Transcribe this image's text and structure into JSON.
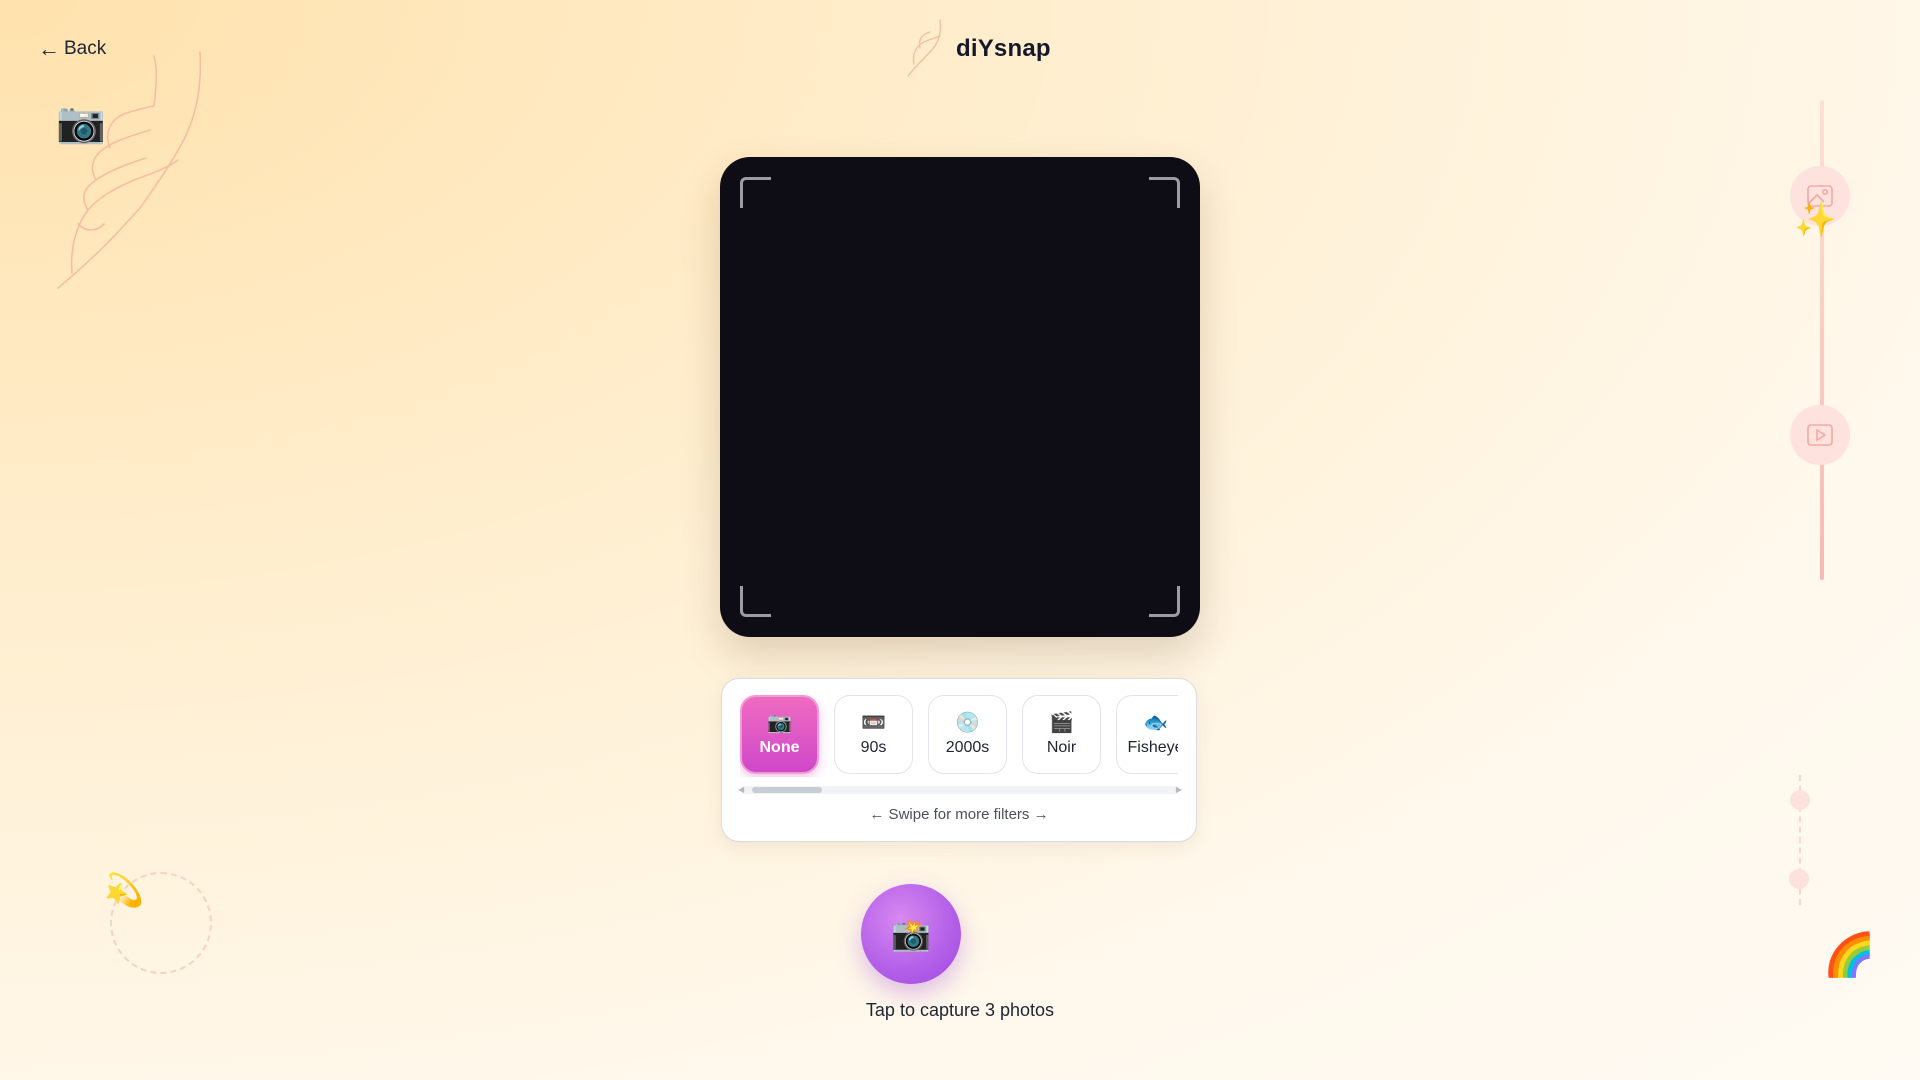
{
  "nav": {
    "back_label": "Back"
  },
  "brand": {
    "title": "diYsnap"
  },
  "filters": {
    "items": [
      {
        "label": "None",
        "icon": "📷"
      },
      {
        "label": "90s",
        "icon": "📼"
      },
      {
        "label": "2000s",
        "icon": "💿"
      },
      {
        "label": "Noir",
        "icon": "🎬"
      },
      {
        "label": "Fisheye",
        "icon": "🐟"
      }
    ],
    "selected": "None",
    "swipe_hint": "← Swipe for more filters →"
  },
  "capture": {
    "icon": "📸",
    "hint": "Tap to capture 3 photos"
  },
  "side_actions": [
    {
      "name": "gallery-icon"
    },
    {
      "name": "play-icon"
    }
  ],
  "decor": {
    "camera": "📷",
    "sparkles": "✨",
    "dizzy": "💫",
    "rainbow": "🌈"
  },
  "colors": {
    "accent_pink": "#e95ec4",
    "capture_purple": "#b25ee8",
    "camera_bg": "#0e0c14",
    "side_pink": "#fde2dd"
  }
}
